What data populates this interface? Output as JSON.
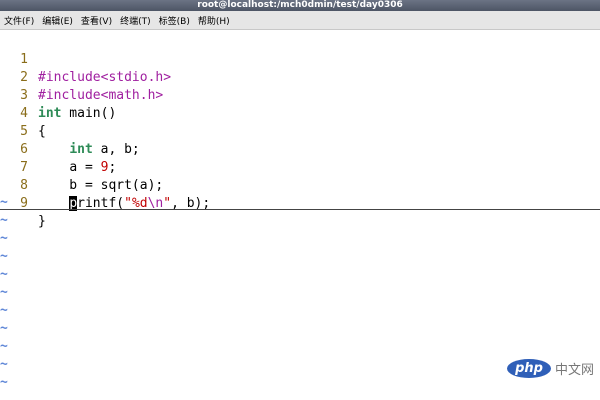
{
  "window": {
    "title": "root@localhost:/mch0dmin/test/day0306"
  },
  "menubar": {
    "items": [
      "文件(F)",
      "编辑(E)",
      "查看(V)",
      "终端(T)",
      "标签(B)",
      "帮助(H)"
    ]
  },
  "editor": {
    "line_numbers": [
      "1",
      "2",
      "3",
      "4",
      "5",
      "6",
      "7",
      "8",
      "9"
    ],
    "line1": {
      "kw": "#include",
      "rest": "<stdio.h>"
    },
    "line2": {
      "kw": "#include",
      "rest": "<math.h>"
    },
    "line3": {
      "type": "int",
      "rest": " main()"
    },
    "line4": {
      "text": "{"
    },
    "line5": {
      "indent": "    ",
      "type": "int",
      "rest": " a, b;"
    },
    "line6": {
      "indent": "    ",
      "pre": "a = ",
      "num": "9",
      "post": ";"
    },
    "line7": {
      "text": "    b = sqrt(a);"
    },
    "line8": {
      "indent": "    ",
      "cursor": "p",
      "pre": "rintf(",
      "q1": "\"",
      "fmt": "%d",
      "esc": "\\n",
      "q2": "\"",
      "post": ", b);"
    },
    "line9": {
      "text": "}"
    },
    "tilde": "~"
  },
  "watermark": {
    "logo": "php",
    "text": "中文网"
  }
}
